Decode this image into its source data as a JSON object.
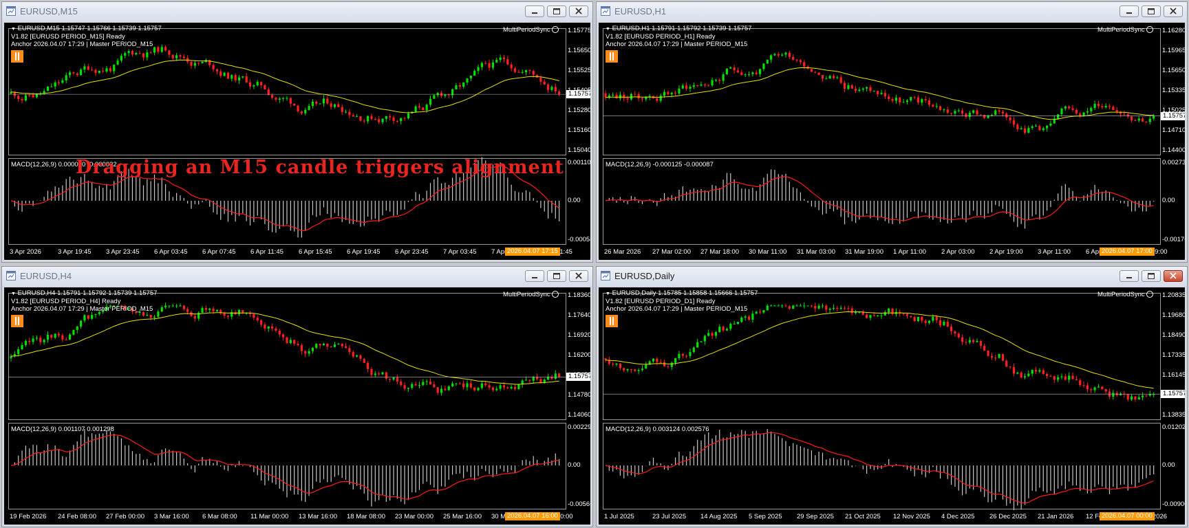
{
  "windows": [
    {
      "key": "m15",
      "title": "EURUSD,M15",
      "active": false,
      "header_line": "EURUSD,M15  1.15747 1.15766 1.15739 1.15757",
      "status_line": "V1.82 [EURUSD PERIOD_M15] Ready",
      "anchor_line": "Anchor 2026.04.07 17:29 | Master PERIOD_M15",
      "indicator_name": "MultiPeriodSync",
      "current_price": "1.15757",
      "price_labels": [
        "1.15775",
        "1.15650",
        "1.15525",
        "1.15405",
        "1.15280",
        "1.15160",
        "1.15040"
      ],
      "macd_label": "MACD(12,26,9) 0.000030 -0.000032",
      "macd_labels": [
        "0.001104",
        "0.00",
        "-0.000584"
      ],
      "time_labels": [
        "3 Apr 2026",
        "3 Apr 19:45",
        "3 Apr 23:45",
        "6 Apr 03:45",
        "6 Apr 07:45",
        "6 Apr 11:45",
        "6 Apr 15:45",
        "6 Apr 19:45",
        "6 Apr 23:45",
        "7 Apr 03:45",
        "7 Apr 07:45",
        "7 Apr 11:45"
      ],
      "time_current": "2026.04.07 17:15"
    },
    {
      "key": "h1",
      "title": "EURUSD,H1",
      "active": false,
      "header_line": "EURUSD,H1  1.15791 1.15792 1.15739 1.15757",
      "status_line": "V1.82 [EURUSD PERIOD_H1] Ready",
      "anchor_line": "Anchor 2026.04.07 17:29 | Master PERIOD_M15",
      "indicator_name": "MultiPeriodSync",
      "current_price": "1.15757",
      "price_labels": [
        "1.16280",
        "1.15965",
        "1.15650",
        "1.15335",
        "1.15025",
        "1.14710",
        "1.14400"
      ],
      "macd_label": "MACD(12,26,9) -0.000125 -0.000087",
      "macd_labels": [
        "0.002734",
        "0.00",
        "-0.001768"
      ],
      "time_labels": [
        "26 Mar 2026",
        "27 Mar 02:00",
        "27 Mar 18:00",
        "30 Mar 11:00",
        "31 Mar 03:00",
        "31 Mar 19:00",
        "1 Apr 11:00",
        "2 Apr 03:00",
        "2 Apr 19:00",
        "3 Apr 11:00",
        "6 Apr 03:00",
        "6 Apr 19:00"
      ],
      "time_current": "2026.04.07 17:00"
    },
    {
      "key": "h4",
      "title": "EURUSD,H4",
      "active": false,
      "header_line": "EURUSD,H4  1.15791 1.15792 1.15739 1.15757",
      "status_line": "V1.82 [EURUSD PERIOD_H4] Ready",
      "anchor_line": "Anchor 2026.04.07 17:29 | Master PERIOD_M15",
      "indicator_name": "MultiPeriodSync",
      "current_price": "1.15757",
      "price_labels": [
        "1.18360",
        "1.17640",
        "1.16920",
        "1.16200",
        "1.15480",
        "1.14780",
        "1.14060"
      ],
      "macd_label": "MACD(12,26,9) 0.001107 0.001298",
      "macd_labels": [
        "0.002296",
        "0.00",
        "-0.005663"
      ],
      "time_labels": [
        "19 Feb 2026",
        "24 Feb 08:00",
        "27 Feb 00:00",
        "3 Mar 16:00",
        "6 Mar 08:00",
        "11 Mar 00:00",
        "13 Mar 16:00",
        "18 Mar 08:00",
        "23 Mar 00:00",
        "25 Mar 16:00",
        "30 Mar 08:00",
        "2 Apr 00:00"
      ],
      "time_current": "2026.04.07 16:00"
    },
    {
      "key": "d1",
      "title": "EURUSD,Daily",
      "active": true,
      "header_line": "EURUSD,Daily  1.15785 1.15858 1.15666 1.15757",
      "status_line": "V1.82 [EURUSD PERIOD_D1] Ready",
      "anchor_line": "Anchor 2026.04.07 17:29 | Master PERIOD_M15",
      "indicator_name": "MultiPeriodSync",
      "current_price": "1.15757",
      "price_labels": [
        "1.20835",
        "1.19680",
        "1.18490",
        "1.17335",
        "1.16145",
        "1.14990",
        "1.13835"
      ],
      "macd_label": "MACD(12,26,9) 0.003124 0.002576",
      "macd_labels": [
        "0.012027",
        "0.00",
        "-0.009003"
      ],
      "time_labels": [
        "1 Jul 2025",
        "23 Jul 2025",
        "14 Aug 2025",
        "5 Sep 2025",
        "29 Sep 2025",
        "21 Oct 2025",
        "12 Nov 2025",
        "4 Dec 2025",
        "26 Dec 2025",
        "21 Jan 2026",
        "12 Feb 2026",
        "6 Mar 2026"
      ],
      "time_current": "2026.04.07 00:00"
    }
  ],
  "overlay_message": "Dragging an M15 candle triggers alignment",
  "colors": {
    "bull": "#00e000",
    "bear": "#ff2020",
    "ma": "#e8e000",
    "signal": "#ff1a1a",
    "hist": "#c8c8c8",
    "accent": "#ff9a00"
  }
}
